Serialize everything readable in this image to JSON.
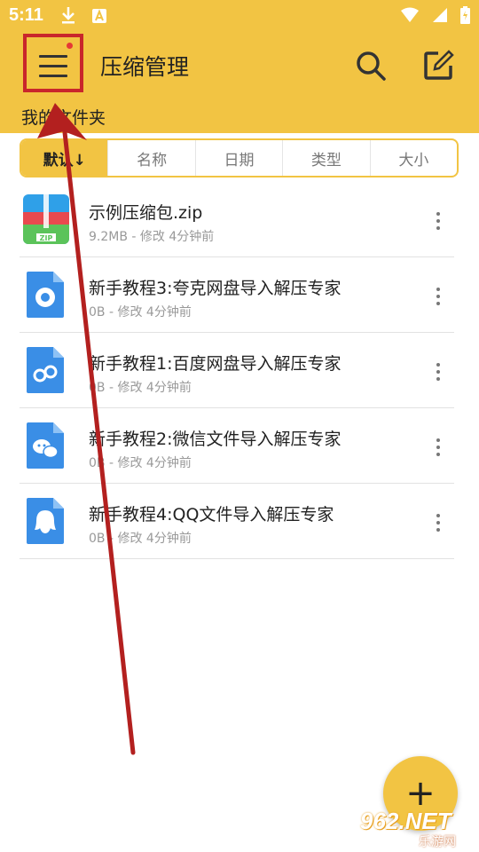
{
  "status_bar": {
    "time": "5:11",
    "icons": [
      "download-icon",
      "a-app-icon",
      "wifi-icon",
      "signal-icon",
      "battery-icon"
    ]
  },
  "header": {
    "title": "压缩管理",
    "menu_icon": "hamburger-menu-icon",
    "search_icon": "search-icon",
    "edit_icon": "edit-icon"
  },
  "breadcrumb": "我的文件夹",
  "sort_tabs": [
    "默认↓",
    "名称",
    "日期",
    "类型",
    "大小"
  ],
  "files": [
    {
      "name": "示例压缩包.zip",
      "meta": "9.2MB - 修改 4分钟前",
      "icon": "zip-archive-icon"
    },
    {
      "name": "新手教程3:夸克网盘导入解压专家",
      "meta": "0B - 修改 4分钟前",
      "icon": "quark-doc-icon"
    },
    {
      "name": "新手教程1:百度网盘导入解压专家",
      "meta": "0B - 修改 4分钟前",
      "icon": "baidu-doc-icon"
    },
    {
      "name": "新手教程2:微信文件导入解压专家",
      "meta": "0B - 修改 4分钟前",
      "icon": "wechat-doc-icon"
    },
    {
      "name": "新手教程4:QQ文件导入解压专家",
      "meta": "0B - 修改 4分钟前",
      "icon": "qq-doc-icon"
    }
  ],
  "fab": {
    "label": "+",
    "icon": "plus-icon"
  },
  "watermark": {
    "text": "962.NET",
    "sub": "乐游网"
  },
  "colors": {
    "accent": "#F2C443",
    "highlight_box": "#C9262B",
    "arrow": "#B3201F",
    "file_icon_blue": "#3A8EE6"
  }
}
